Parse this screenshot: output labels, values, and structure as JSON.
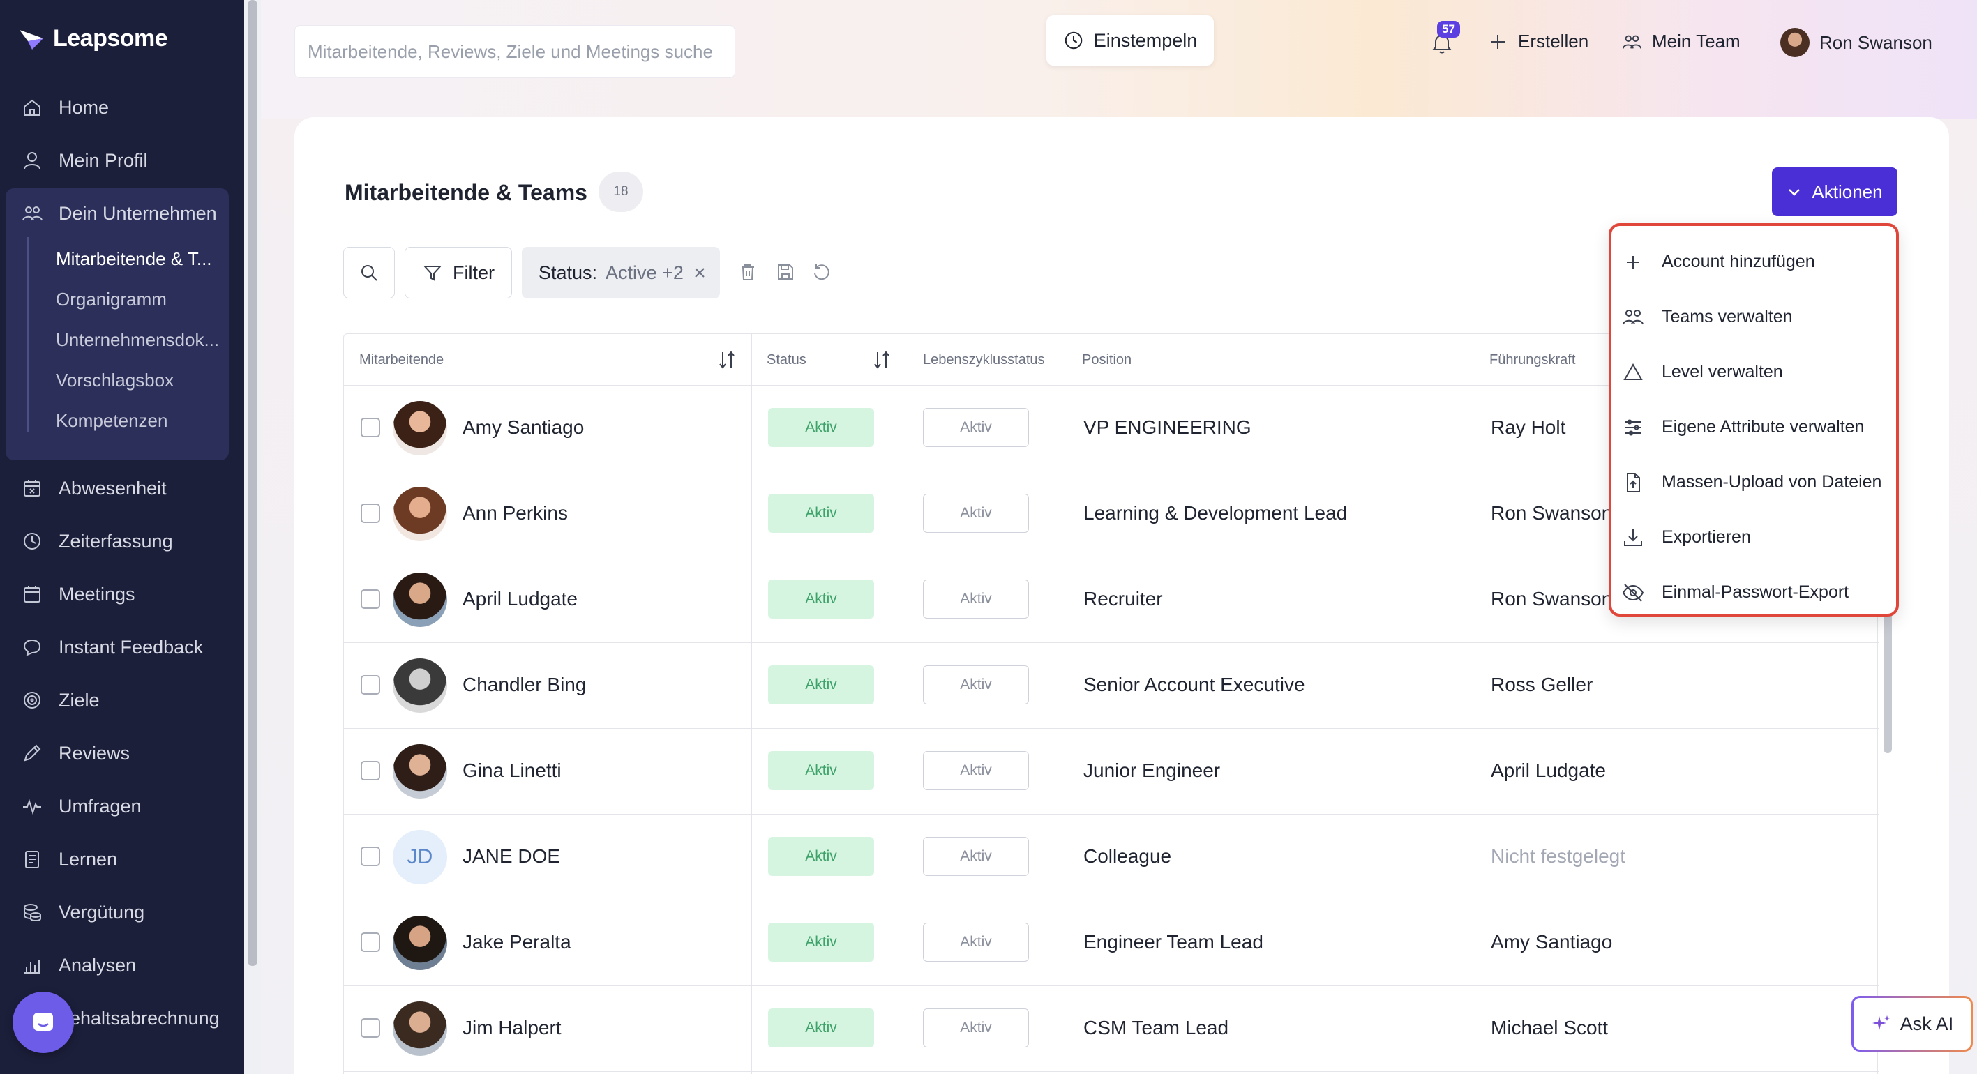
{
  "app": {
    "name": "Leapsome"
  },
  "sidebar": {
    "items": [
      {
        "label": "Home",
        "icon": "home-icon"
      },
      {
        "label": "Mein Profil",
        "icon": "user-icon"
      },
      {
        "label": "Dein Unternehmen",
        "icon": "users-icon"
      },
      {
        "label": "Abwesenheit",
        "icon": "calendar-x-icon"
      },
      {
        "label": "Zeiterfassung",
        "icon": "clock-icon"
      },
      {
        "label": "Meetings",
        "icon": "calendar-icon"
      },
      {
        "label": "Instant Feedback",
        "icon": "chat-icon"
      },
      {
        "label": "Ziele",
        "icon": "target-icon"
      },
      {
        "label": "Reviews",
        "icon": "pen-icon"
      },
      {
        "label": "Umfragen",
        "icon": "pulse-icon"
      },
      {
        "label": "Lernen",
        "icon": "book-icon"
      },
      {
        "label": "Vergütung",
        "icon": "coins-icon"
      },
      {
        "label": "Analysen",
        "icon": "chart-icon"
      },
      {
        "label": "ehaltsabrechnung",
        "icon": "payroll-icon"
      }
    ],
    "sub_items": [
      {
        "label": "Mitarbeitende & T..."
      },
      {
        "label": "Organigramm"
      },
      {
        "label": "Unternehmensdok..."
      },
      {
        "label": "Vorschlagsbox"
      },
      {
        "label": "Kompetenzen"
      }
    ]
  },
  "topbar": {
    "search_placeholder": "Mitarbeitende, Reviews, Ziele und Meetings suche",
    "clock_in_label": "Einstempeln",
    "notification_count": "57",
    "create_label": "Erstellen",
    "my_team_label": "Mein Team",
    "user_name": "Ron Swanson"
  },
  "page": {
    "title": "Mitarbeitende & Teams",
    "count": "18",
    "actions_label": "Aktionen",
    "filter_label": "Filter",
    "status_filter": {
      "label": "Status:",
      "value": "Active +2"
    }
  },
  "table": {
    "headers": {
      "employee": "Mitarbeitende",
      "status": "Status",
      "lifecycle": "Lebenszyklusstatus",
      "position": "Position",
      "manager": "Führungskraft"
    },
    "rows": [
      {
        "name": "Amy Santiago",
        "status": "Aktiv",
        "lifecycle": "Aktiv",
        "position": "VP ENGINEERING",
        "manager": "Ray Holt",
        "initials": ""
      },
      {
        "name": "Ann Perkins",
        "status": "Aktiv",
        "lifecycle": "Aktiv",
        "position": "Learning & Development Lead",
        "manager": "Ron Swanson",
        "initials": ""
      },
      {
        "name": "April Ludgate",
        "status": "Aktiv",
        "lifecycle": "Aktiv",
        "position": "Recruiter",
        "manager": "Ron Swanson",
        "initials": ""
      },
      {
        "name": "Chandler Bing",
        "status": "Aktiv",
        "lifecycle": "Aktiv",
        "position": "Senior Account Executive",
        "manager": "Ross Geller",
        "initials": ""
      },
      {
        "name": "Gina Linetti",
        "status": "Aktiv",
        "lifecycle": "Aktiv",
        "position": "Junior Engineer",
        "manager": "April Ludgate",
        "initials": ""
      },
      {
        "name": "JANE DOE",
        "status": "Aktiv",
        "lifecycle": "Aktiv",
        "position": "Colleague",
        "manager": "Nicht festgelegt",
        "initials": "JD"
      },
      {
        "name": "Jake Peralta",
        "status": "Aktiv",
        "lifecycle": "Aktiv",
        "position": "Engineer Team Lead",
        "manager": "Amy Santiago",
        "initials": ""
      },
      {
        "name": "Jim Halpert",
        "status": "Aktiv",
        "lifecycle": "Aktiv",
        "position": "CSM Team Lead",
        "manager": "Michael Scott",
        "initials": ""
      }
    ]
  },
  "actions_menu": {
    "items": [
      {
        "label": "Account hinzufügen",
        "icon": "plus-icon"
      },
      {
        "label": "Teams verwalten",
        "icon": "users-icon"
      },
      {
        "label": "Level verwalten",
        "icon": "triangle-icon"
      },
      {
        "label": "Eigene Attribute verwalten",
        "icon": "sliders-icon"
      },
      {
        "label": "Massen-Upload von Dateien",
        "icon": "file-upload-icon"
      },
      {
        "label": "Exportieren",
        "icon": "download-icon"
      },
      {
        "label": "Einmal-Passwort-Export",
        "icon": "eye-off-icon"
      }
    ]
  },
  "ask_ai": {
    "label": "Ask AI"
  },
  "colors": {
    "sidebar_bg": "#1c1f3a",
    "accent": "#4b2fd6",
    "active_status_bg": "#d6f5e1",
    "active_status_text": "#3fa26a",
    "highlight_border": "#e0463a"
  }
}
